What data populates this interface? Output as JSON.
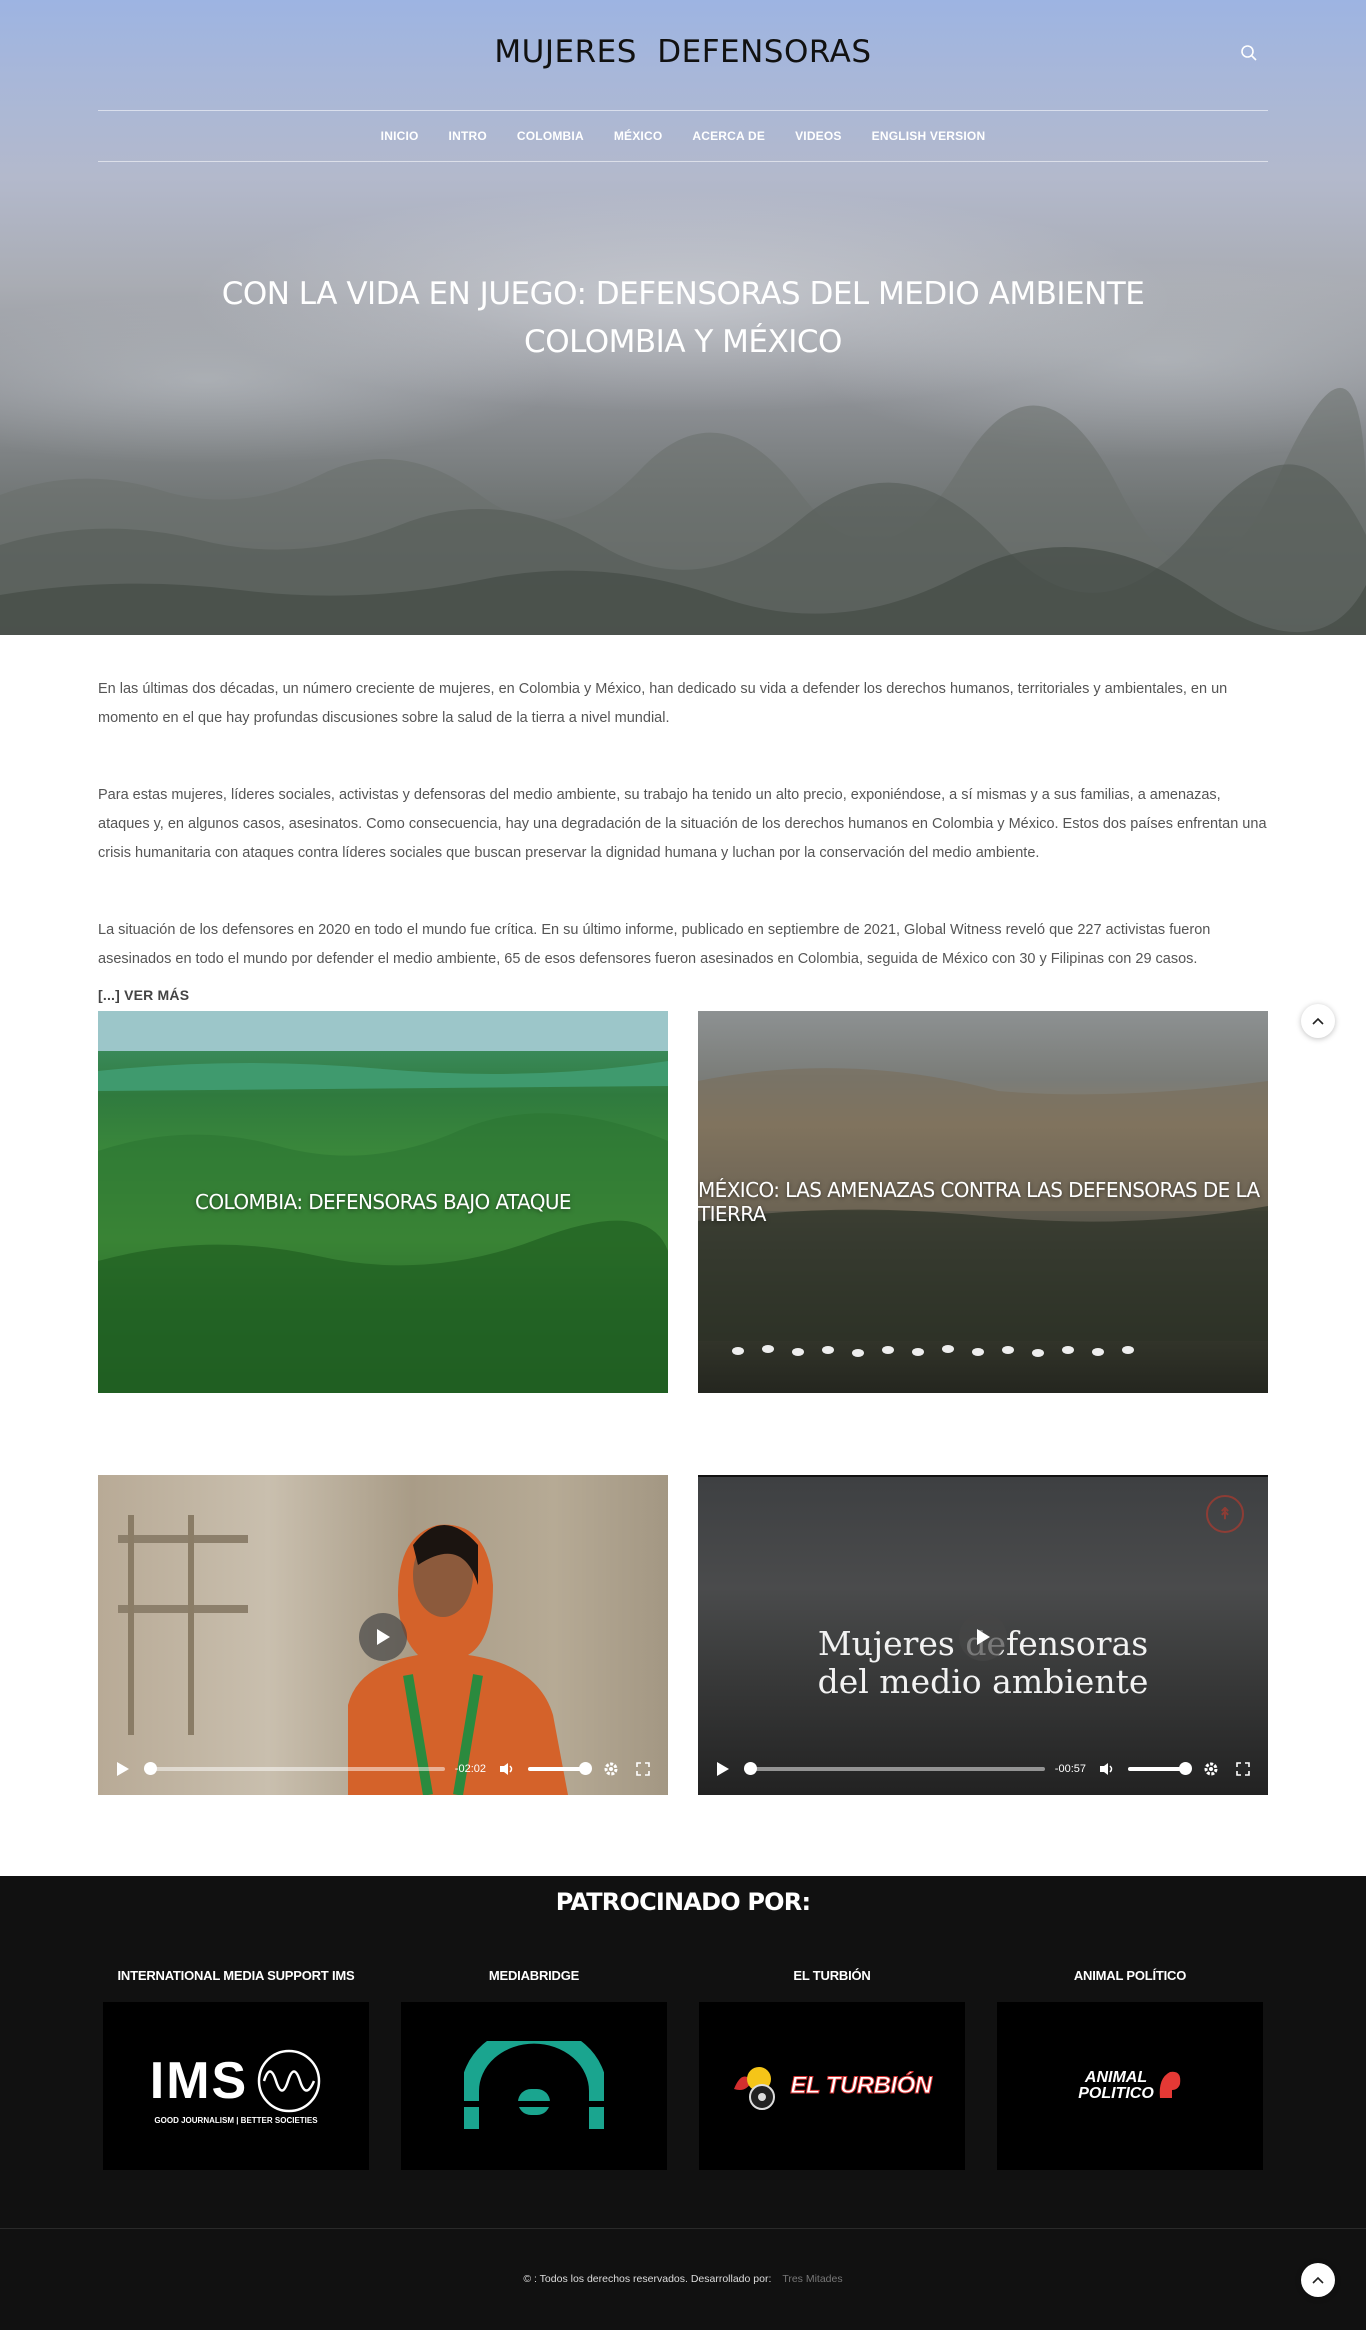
{
  "site": {
    "title": "MUJERES   DEFENSORAS",
    "nav": [
      "INICIO",
      "INTRO",
      "COLOMBIA",
      "MÉXICO",
      "ACERCA DE",
      "VIDEOS",
      "ENGLISH VERSION"
    ]
  },
  "hero": {
    "heading_line1": "CON LA VIDA EN JUEGO: DEFENSORAS DEL MEDIO AMBIENTE",
    "heading_line2": "COLOMBIA Y MÉXICO"
  },
  "intro": {
    "p1": "En las últimas dos décadas, un número creciente de mujeres, en Colombia y México, han dedicado su vida a defender los derechos humanos, territoriales y ambientales, en un momento en el que hay profundas discusiones sobre la salud de la tierra a nivel mundial.",
    "p2": "Para estas mujeres, líderes sociales, activistas y defensoras del medio ambiente, su trabajo ha tenido un alto precio, exponiéndose, a sí mismas y a sus familias, a amenazas, ataques y, en algunos casos, asesinatos. Como consecuencia, hay una degradación de la situación de los derechos humanos en Colombia y México. Estos dos países enfrentan una crisis humanitaria con ataques contra líderes sociales que buscan preservar la dignidad humana y luchan por la conservación del medio ambiente.",
    "p3": "La situación de los defensores en 2020 en todo el mundo fue crítica. En su último informe, publicado en septiembre de 2021, Global Witness reveló que 227 activistas fueron asesinados en todo el mundo por defender el medio ambiente, 65 de esos defensores fueron asesinados en Colombia, seguida de México con 30 y Filipinas con 29 casos.",
    "read_more": "[...] VER MÁS"
  },
  "cards": {
    "colombia": "COLOMBIA: DEFENSORAS BAJO ATAQUE",
    "mexico": "MÉXICO: LAS AMENAZAS CONTRA LAS DEFENSORAS DE LA TIERRA"
  },
  "videos": {
    "v1_time": "-02:02",
    "v2_time": "-00:57",
    "v2_title_line1": "Mujeres defensoras",
    "v2_title_line2": "del medio ambiente"
  },
  "sponsors": {
    "heading": "PATROCINADO POR:",
    "items": [
      {
        "name": "INTERNATIONAL MEDIA SUPPORT IMS",
        "logo_text": "IMS",
        "tagline": "GOOD JOURNALISM | BETTER SOCIETIES"
      },
      {
        "name": "MEDIABRIDGE"
      },
      {
        "name": "EL TURBIÓN",
        "logo_text": "EL TURBIÓN"
      },
      {
        "name": "ANIMAL POLÍTICO",
        "logo_line1": "ANIMAL",
        "logo_line2": "POLITICO"
      }
    ]
  },
  "footer": {
    "copyright": "© : Todos los derechos reservados. Desarrollado por:",
    "developer": "Tres Mitades"
  },
  "colors": {
    "mediabridge": "#1aa58f",
    "turbion_red": "#d32f2f",
    "animal_red": "#e53935"
  }
}
